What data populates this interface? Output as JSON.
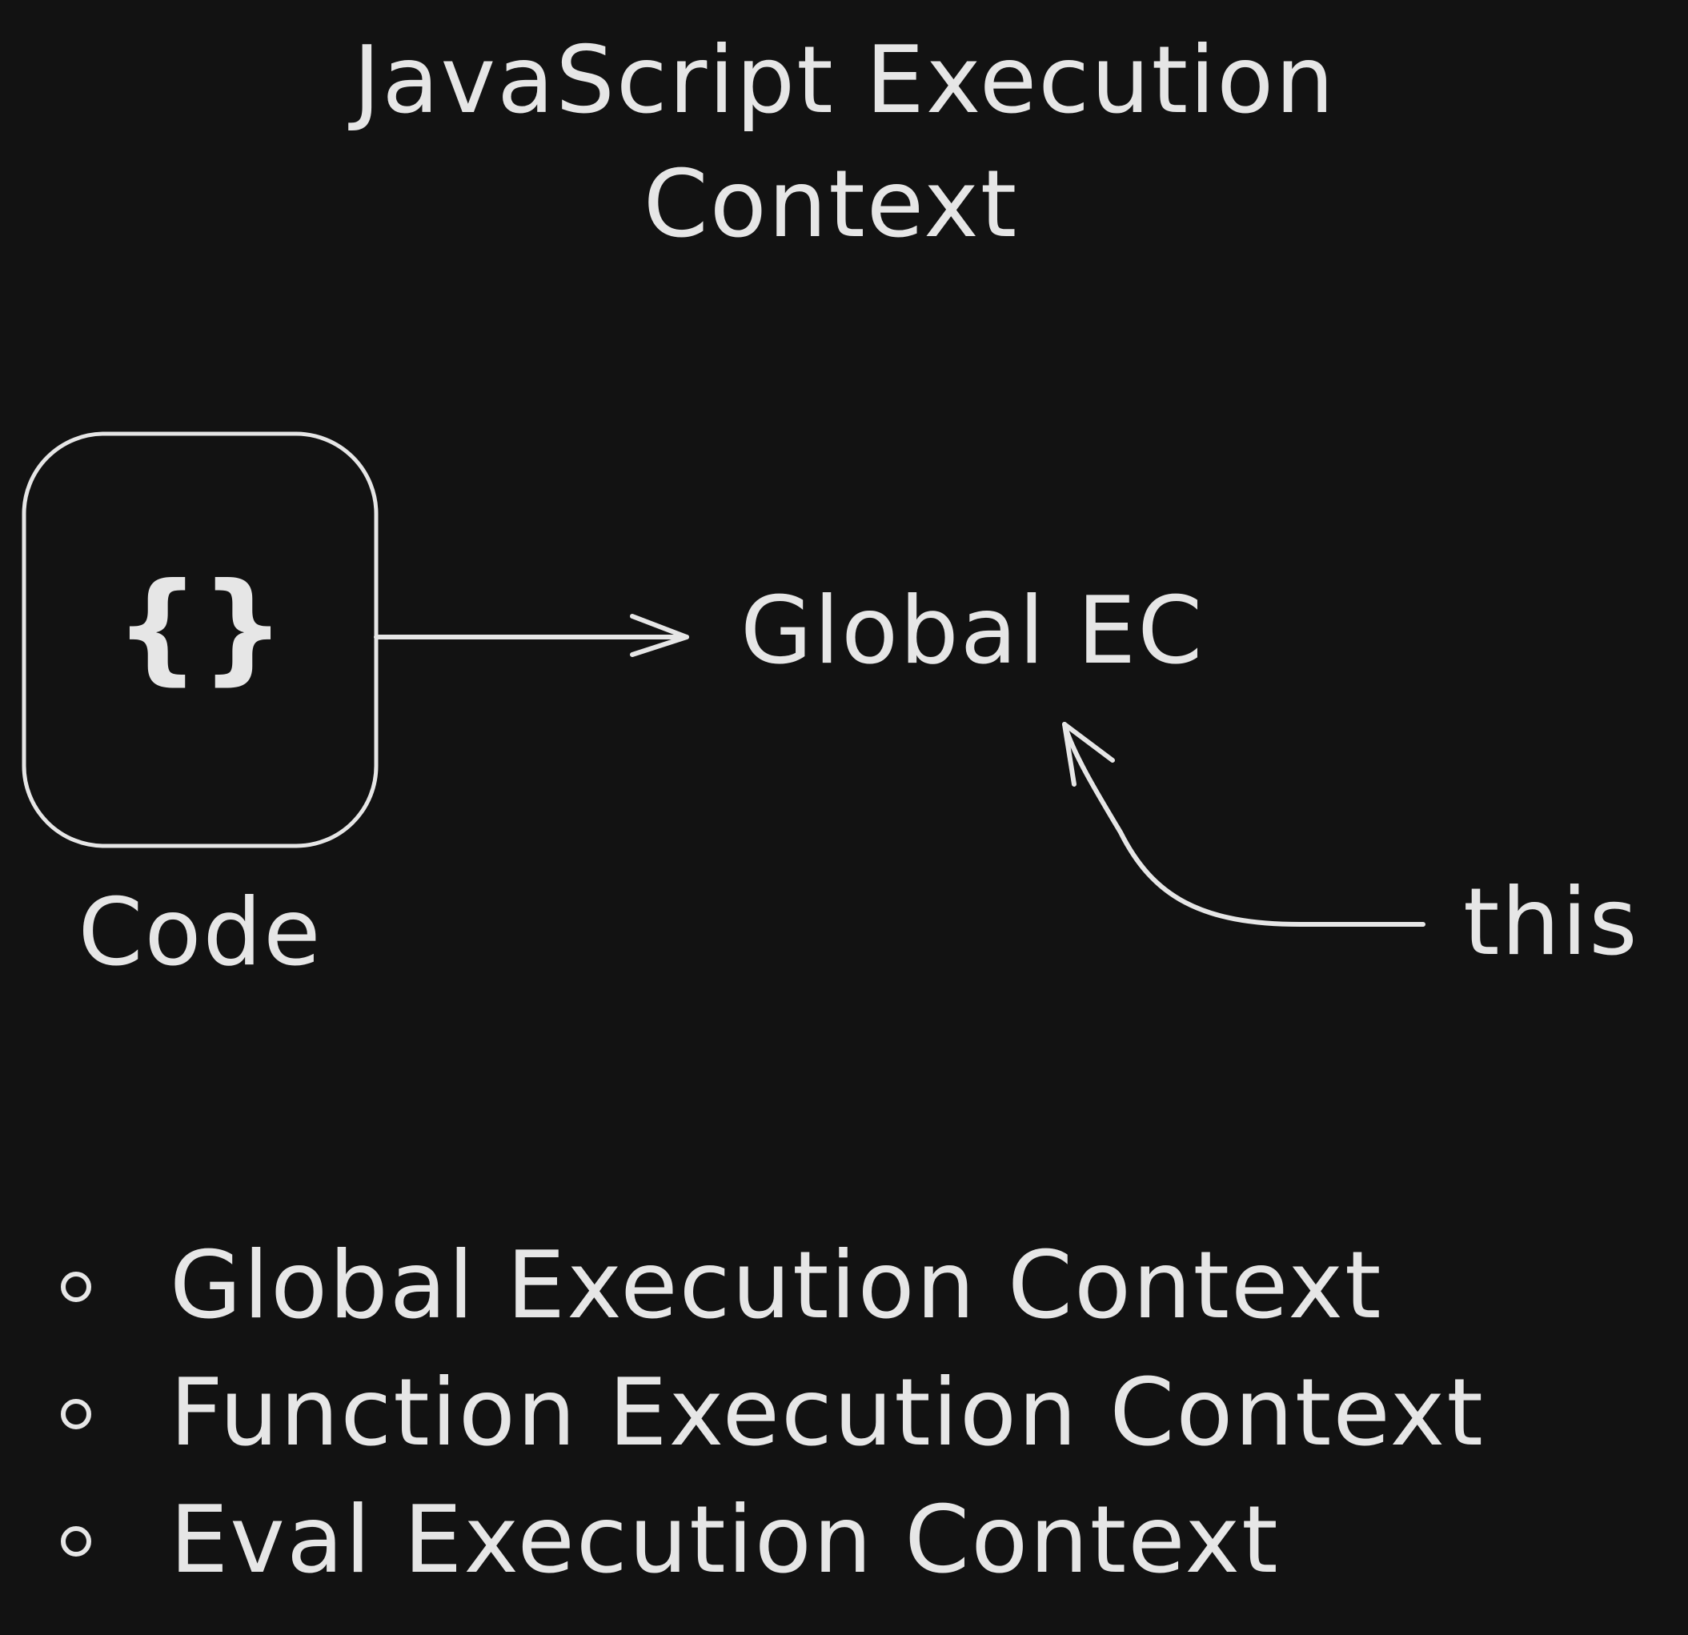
{
  "title_line1": "JavaScript Execution",
  "title_line2": "Context",
  "code_label": "Code",
  "braces": "{}",
  "global_ec": "Global EC",
  "this_label": "this",
  "list_items": [
    "Global Execution Context",
    "Function Execution Context",
    "Eval Execution Context"
  ],
  "colors": {
    "background": "#121212",
    "stroke": "#e6e6e6"
  }
}
